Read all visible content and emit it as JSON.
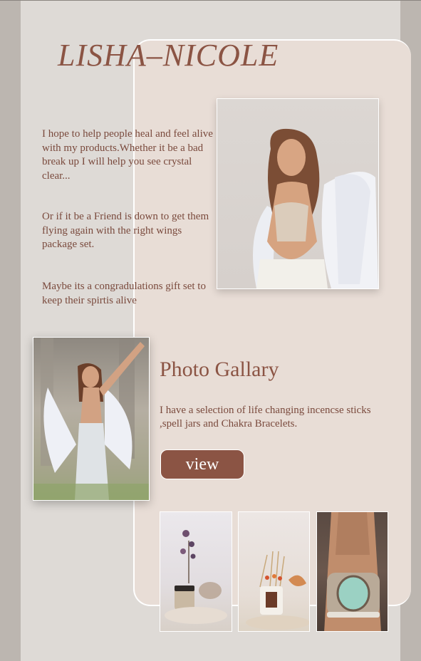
{
  "brand": {
    "name": "LISHA–NICOLE"
  },
  "intro": {
    "paragraphs": [
      "I hope to help people heal and feel alive with my products.Whether it be a bad break up I will help you see crystal clear...",
      "Or if it be a Friend is down to get them flying again with the right wings package set.",
      "Maybe its a congradulations gift set to keep their spirtis alive"
    ]
  },
  "gallery": {
    "title": "Photo Gallary",
    "description": "I have a selection of life changing incencse sticks ,spell jars and Chakra Bracelets.",
    "view_label": "view"
  },
  "colors": {
    "brand": "#8b5444",
    "text": "#7a4a3d",
    "panel": "#e8ddd6",
    "page": "#dedad6",
    "sidebar": "#bcb6b0"
  }
}
